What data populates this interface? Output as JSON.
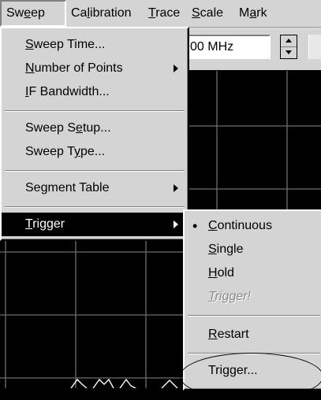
{
  "menubar": {
    "items": [
      {
        "label": "Sweep",
        "accel": "e"
      },
      {
        "label": "Calibration",
        "accel": "l"
      },
      {
        "label": "Trace",
        "accel": "T"
      },
      {
        "label": "Scale",
        "accel": "S"
      },
      {
        "label": "Mark",
        "accel": "a"
      }
    ]
  },
  "toolbar": {
    "frequency_value": "00 MHz"
  },
  "sweep_menu": {
    "items": [
      {
        "label": "Sweep Time..."
      },
      {
        "label": "Number of Points"
      },
      {
        "label": "IF Bandwidth..."
      },
      {
        "label": "Sweep Setup..."
      },
      {
        "label": "Sweep Type..."
      },
      {
        "label": "Segment Table"
      },
      {
        "label": "Trigger"
      }
    ]
  },
  "trigger_menu": {
    "items": [
      {
        "label": "Continuous",
        "checked": true
      },
      {
        "label": "Single"
      },
      {
        "label": "Hold"
      },
      {
        "label": "Trigger!",
        "disabled": true
      },
      {
        "label": "Restart"
      },
      {
        "label": "Trigger..."
      }
    ]
  },
  "colors": {
    "menu_bg": "#d4d4d4",
    "highlight_bg": "#000000",
    "highlight_fg": "#ffffff",
    "plot_bg": "#000000",
    "grid": "#6e6e6e",
    "trace": "#ffffff"
  }
}
